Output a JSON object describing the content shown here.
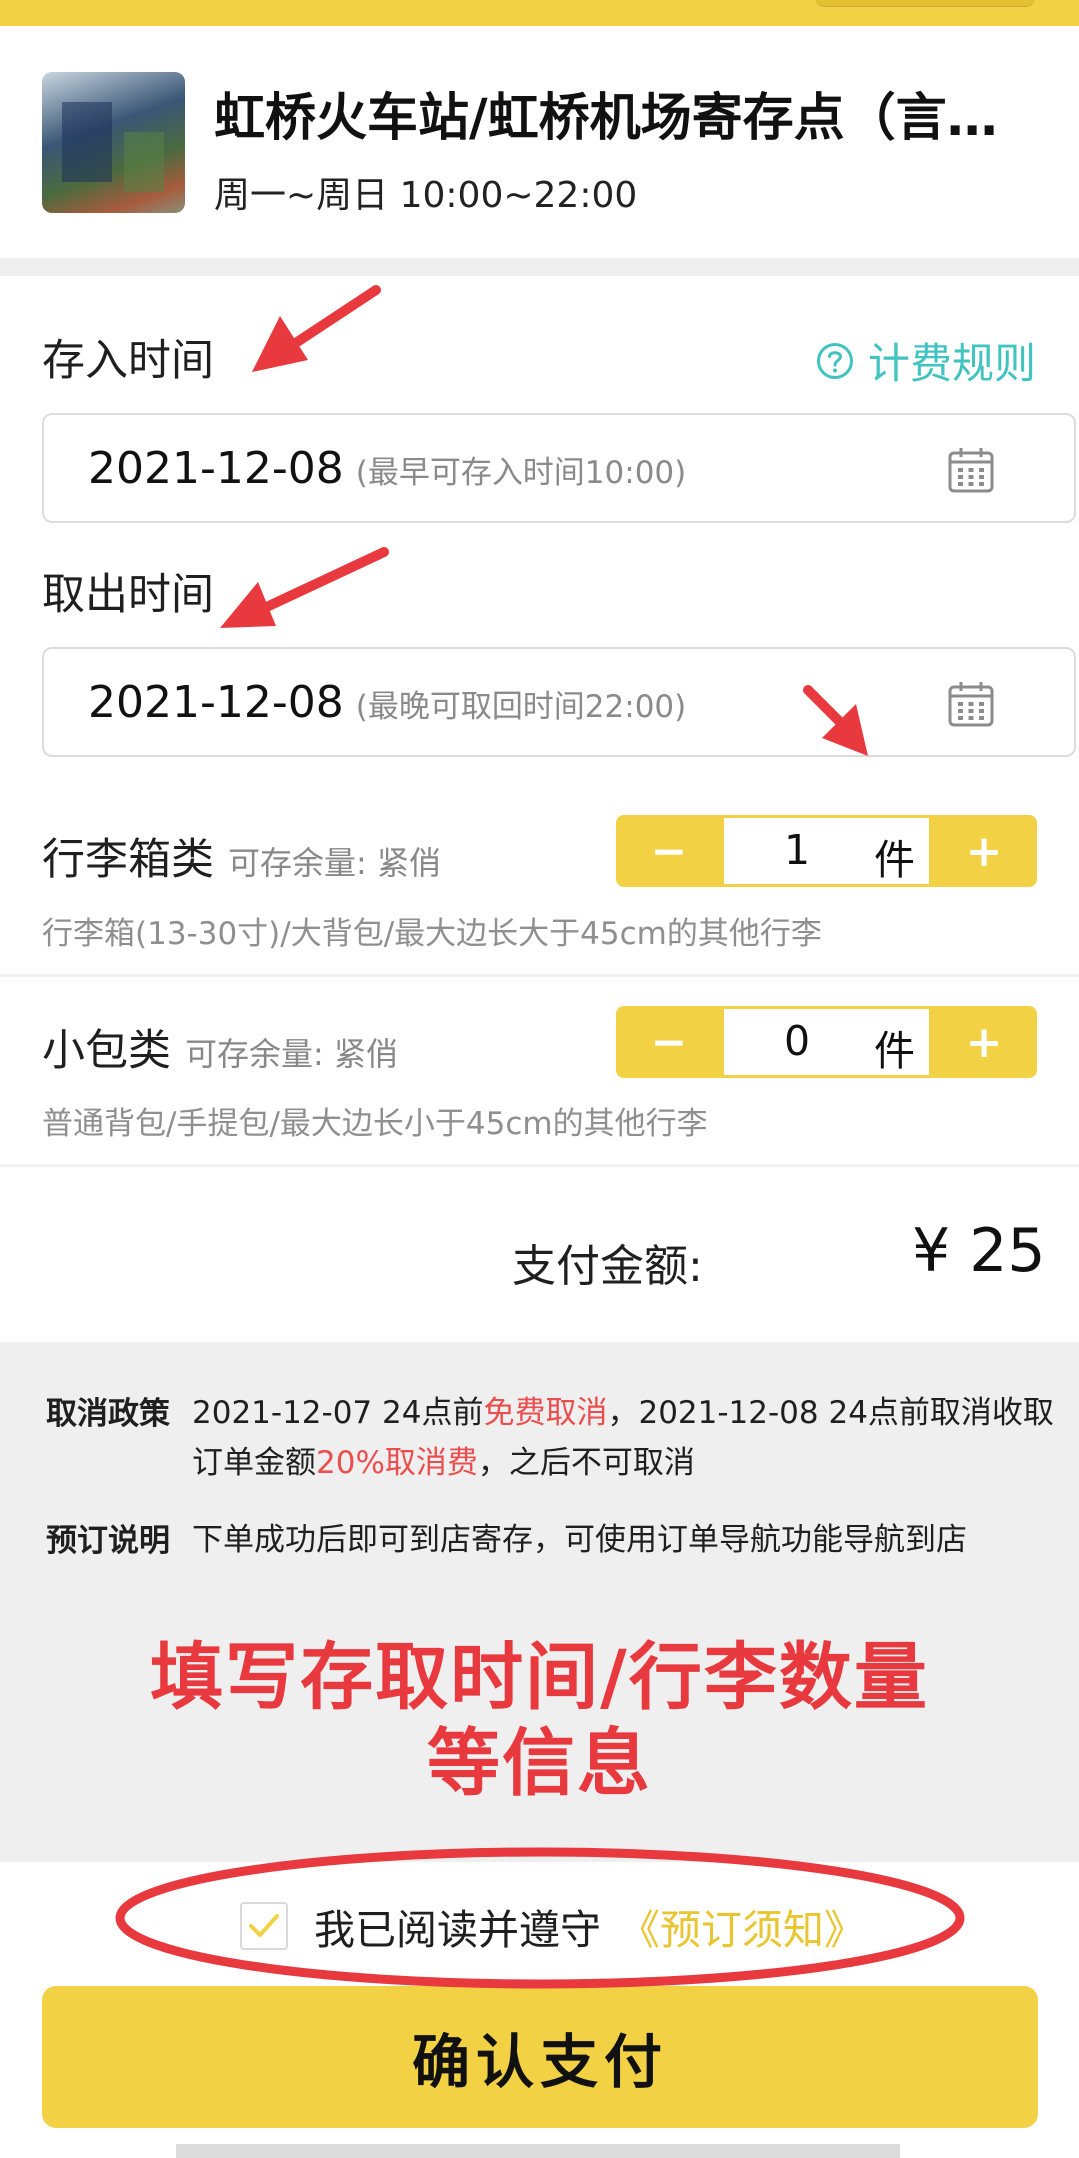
{
  "store": {
    "name": "虹桥火车站/虹桥机场寄存点（言…",
    "hours": "周一~周日 10:00~22:00"
  },
  "deposit": {
    "label": "存入时间",
    "date": "2021-12-08",
    "hint": "(最早可存入时间10:00)"
  },
  "fee_rules": {
    "label": "计费规则",
    "icon": "question-circle-icon"
  },
  "pickup": {
    "label": "取出时间",
    "date": "2021-12-08",
    "hint": "(最晚可取回时间22:00)"
  },
  "items": [
    {
      "title": "行李箱类",
      "stock": "可存余量: 紧俏",
      "desc": "行李箱(13-30寸)/大背包/最大边长大于45cm的其他行李",
      "count": "1",
      "unit": "件"
    },
    {
      "title": "小包类",
      "stock": "可存余量: 紧俏",
      "desc": "普通背包/手提包/最大边长小于45cm的其他行李",
      "count": "0",
      "unit": "件"
    }
  ],
  "stepper": {
    "minus": "−",
    "plus": "+"
  },
  "payment": {
    "label": "支付金额:",
    "amount": "¥ 25"
  },
  "policy": {
    "cancel_head": "取消政策",
    "cancel_part1": "2021-12-07 24点前",
    "cancel_part2": "免费取消",
    "cancel_part3": "，2021-12-08 24点前取消收取订单金额",
    "cancel_part4": "20%取消费",
    "cancel_part5": "，之后不可取消",
    "booking_head": "预订说明",
    "booking_body": "下单成功后即可到店寄存，可使用订单导航功能导航到店"
  },
  "annotation": {
    "line1": "填写存取时间/行李数量",
    "line2": "等信息"
  },
  "agreement": {
    "checked": true,
    "text": "我已阅读并遵守",
    "link": "《预订须知》"
  },
  "confirm_button": "确认支付",
  "colors": {
    "accent_yellow": "#f2d244",
    "teal": "#41c3c0",
    "annotation_red": "#e8393f"
  }
}
